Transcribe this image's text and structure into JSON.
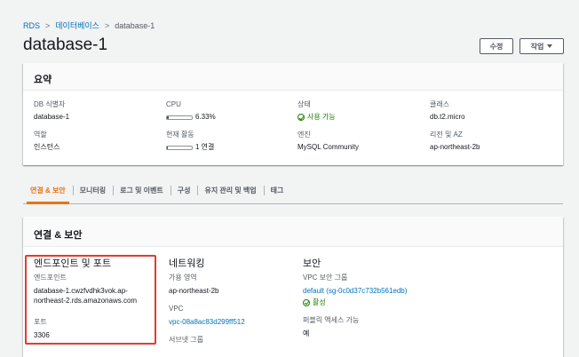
{
  "breadcrumb": {
    "rds": "RDS",
    "databases": "데이터베이스",
    "current": "database-1",
    "separator": ">"
  },
  "page": {
    "title": "database-1"
  },
  "toolbar": {
    "edit_label": "수정",
    "actions_label": "작업"
  },
  "summary": {
    "title": "요약",
    "db_identifier": {
      "label": "DB 식별자",
      "value": "database-1"
    },
    "role": {
      "label": "역할",
      "value": "인스턴스"
    },
    "cpu": {
      "label": "CPU",
      "value": "6.33%",
      "meter_fraction": 0.0633
    },
    "activity": {
      "label": "현재 활동",
      "value": "1 연결",
      "meter_fraction": 0.05
    },
    "status": {
      "label": "상태",
      "value": "사용 가능"
    },
    "engine": {
      "label": "엔진",
      "value": "MySQL Community"
    },
    "class": {
      "label": "클래스",
      "value": "db.t2.micro"
    },
    "region": {
      "label": "리전 및 AZ",
      "value": "ap-northeast-2b"
    }
  },
  "tabs": [
    {
      "label": "연결 & 보안",
      "active": true
    },
    {
      "label": "모니터링",
      "active": false
    },
    {
      "label": "로그 및 이벤트",
      "active": false
    },
    {
      "label": "구성",
      "active": false
    },
    {
      "label": "유지 관리 및 백업",
      "active": false
    },
    {
      "label": "태그",
      "active": false
    }
  ],
  "connectivity": {
    "title": "연결 & 보안",
    "endpoint_section": {
      "title": "엔드포인트 및 포트",
      "endpoint_label": "엔드포인트",
      "endpoint_value_line1": "database-1.cwzfvdhk3vok.ap-",
      "endpoint_value_line2": "northeast-2.rds.amazonaws.com",
      "port_label": "포트",
      "port_value": "3306"
    },
    "networking_section": {
      "title": "네트워킹",
      "az_label": "가용 영역",
      "az_value": "ap-northeast-2b",
      "vpc_label": "VPC",
      "vpc_value": "vpc-08a8ac83d299ff512",
      "subnet_label": "서브넷 그룹"
    },
    "security_section": {
      "title": "보안",
      "sg_label": "VPC 보안 그룹",
      "sg_value": "default (sg-0c0d37c732b561edb)",
      "sg_status": "활성",
      "public_label": "퍼블릭 액세스 가능",
      "public_value": "예"
    }
  },
  "colors": {
    "link": "#0073bb",
    "active_tab": "#ec7211",
    "success": "#1d8102",
    "highlight": "#e03c31"
  }
}
